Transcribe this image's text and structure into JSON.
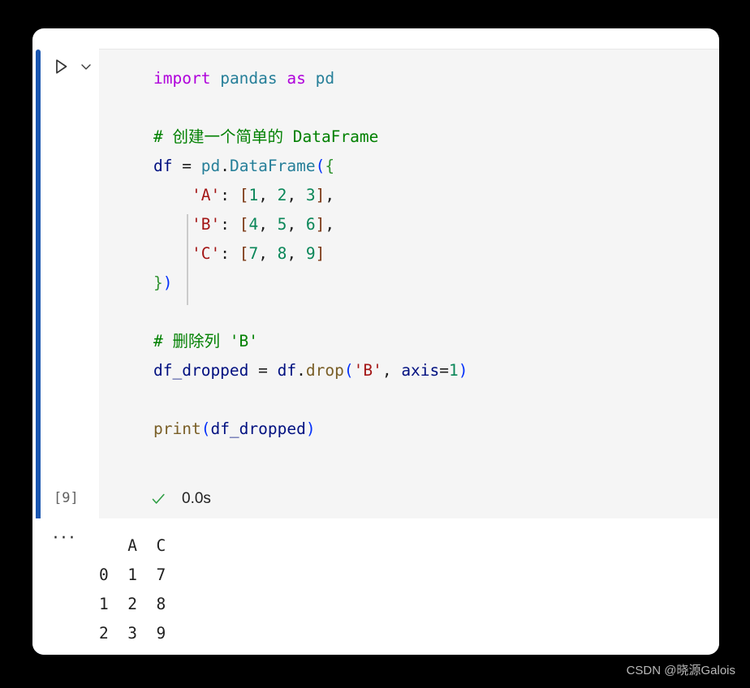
{
  "cell": {
    "execution_count": "[9]",
    "run_button_label": "run-cell",
    "collapse_label": "more-actions",
    "status": {
      "check": "success",
      "duration": "0.0s"
    },
    "output_collapse": "···"
  },
  "code": {
    "lines": [
      [
        {
          "text": "import",
          "cls": "t-kw"
        },
        {
          "text": " ",
          "cls": "t-plain"
        },
        {
          "text": "pandas",
          "cls": "t-mod"
        },
        {
          "text": " ",
          "cls": "t-plain"
        },
        {
          "text": "as",
          "cls": "t-kw"
        },
        {
          "text": " ",
          "cls": "t-plain"
        },
        {
          "text": "pd",
          "cls": "t-mod"
        }
      ],
      [],
      [
        {
          "text": "# 创建一个简单的 DataFrame",
          "cls": "t-cmt"
        }
      ],
      [
        {
          "text": "df",
          "cls": "t-var"
        },
        {
          "text": " = ",
          "cls": "t-plain"
        },
        {
          "text": "pd",
          "cls": "t-mod"
        },
        {
          "text": ".",
          "cls": "t-plain"
        },
        {
          "text": "DataFrame",
          "cls": "t-mod"
        },
        {
          "text": "(",
          "cls": "t-br1"
        },
        {
          "text": "{",
          "cls": "t-br2"
        }
      ],
      [
        {
          "text": "    ",
          "cls": "t-plain"
        },
        {
          "text": "'A'",
          "cls": "t-str"
        },
        {
          "text": ": ",
          "cls": "t-plain"
        },
        {
          "text": "[",
          "cls": "t-br3"
        },
        {
          "text": "1",
          "cls": "t-num"
        },
        {
          "text": ", ",
          "cls": "t-plain"
        },
        {
          "text": "2",
          "cls": "t-num"
        },
        {
          "text": ", ",
          "cls": "t-plain"
        },
        {
          "text": "3",
          "cls": "t-num"
        },
        {
          "text": "]",
          "cls": "t-br3"
        },
        {
          "text": ",",
          "cls": "t-plain"
        }
      ],
      [
        {
          "text": "    ",
          "cls": "t-plain"
        },
        {
          "text": "'B'",
          "cls": "t-str"
        },
        {
          "text": ": ",
          "cls": "t-plain"
        },
        {
          "text": "[",
          "cls": "t-br3"
        },
        {
          "text": "4",
          "cls": "t-num"
        },
        {
          "text": ", ",
          "cls": "t-plain"
        },
        {
          "text": "5",
          "cls": "t-num"
        },
        {
          "text": ", ",
          "cls": "t-plain"
        },
        {
          "text": "6",
          "cls": "t-num"
        },
        {
          "text": "]",
          "cls": "t-br3"
        },
        {
          "text": ",",
          "cls": "t-plain"
        }
      ],
      [
        {
          "text": "    ",
          "cls": "t-plain"
        },
        {
          "text": "'C'",
          "cls": "t-str"
        },
        {
          "text": ": ",
          "cls": "t-plain"
        },
        {
          "text": "[",
          "cls": "t-br3"
        },
        {
          "text": "7",
          "cls": "t-num"
        },
        {
          "text": ", ",
          "cls": "t-plain"
        },
        {
          "text": "8",
          "cls": "t-num"
        },
        {
          "text": ", ",
          "cls": "t-plain"
        },
        {
          "text": "9",
          "cls": "t-num"
        },
        {
          "text": "]",
          "cls": "t-br3"
        }
      ],
      [
        {
          "text": "}",
          "cls": "t-br2"
        },
        {
          "text": ")",
          "cls": "t-br1"
        }
      ],
      [],
      [
        {
          "text": "# 删除列 'B'",
          "cls": "t-cmt"
        }
      ],
      [
        {
          "text": "df_dropped",
          "cls": "t-var"
        },
        {
          "text": " = ",
          "cls": "t-plain"
        },
        {
          "text": "df",
          "cls": "t-var"
        },
        {
          "text": ".",
          "cls": "t-plain"
        },
        {
          "text": "drop",
          "cls": "t-fn"
        },
        {
          "text": "(",
          "cls": "t-br1"
        },
        {
          "text": "'B'",
          "cls": "t-str"
        },
        {
          "text": ", ",
          "cls": "t-plain"
        },
        {
          "text": "axis",
          "cls": "t-var"
        },
        {
          "text": "=",
          "cls": "t-plain"
        },
        {
          "text": "1",
          "cls": "t-num"
        },
        {
          "text": ")",
          "cls": "t-br1"
        }
      ],
      [],
      [
        {
          "text": "print",
          "cls": "t-fn"
        },
        {
          "text": "(",
          "cls": "t-br1"
        },
        {
          "text": "df_dropped",
          "cls": "t-var"
        },
        {
          "text": ")",
          "cls": "t-br1"
        }
      ]
    ],
    "plain_text": "import pandas as pd\n\n# 创建一个简单的 DataFrame\ndf = pd.DataFrame({\n    'A': [1, 2, 3],\n    'B': [4, 5, 6],\n    'C': [7, 8, 9]\n})\n\n# 删除列 'B'\ndf_dropped = df.drop('B', axis=1)\n\nprint(df_dropped)"
  },
  "output": {
    "header": "   A  C",
    "rows": [
      "0  1  7",
      "1  2  8",
      "2  3  9"
    ],
    "text": "   A  C\n0  1  7\n1  2  8\n2  3  9",
    "columns": [
      "A",
      "C"
    ],
    "index": [
      "0",
      "1",
      "2"
    ],
    "values": [
      [
        "1",
        "7"
      ],
      [
        "2",
        "8"
      ],
      [
        "3",
        "9"
      ]
    ]
  },
  "watermark": "CSDN @晓源Galois",
  "colors": {
    "accent": "#1a56b0",
    "editor_bg": "#f5f5f5",
    "card_bg": "#ffffff",
    "page_bg": "#000000",
    "success": "#2e9e44",
    "keyword": "#af00db",
    "module": "#267f99",
    "function": "#795e26",
    "variable": "#001080",
    "string": "#a31515",
    "number": "#098658",
    "comment": "#008000"
  }
}
